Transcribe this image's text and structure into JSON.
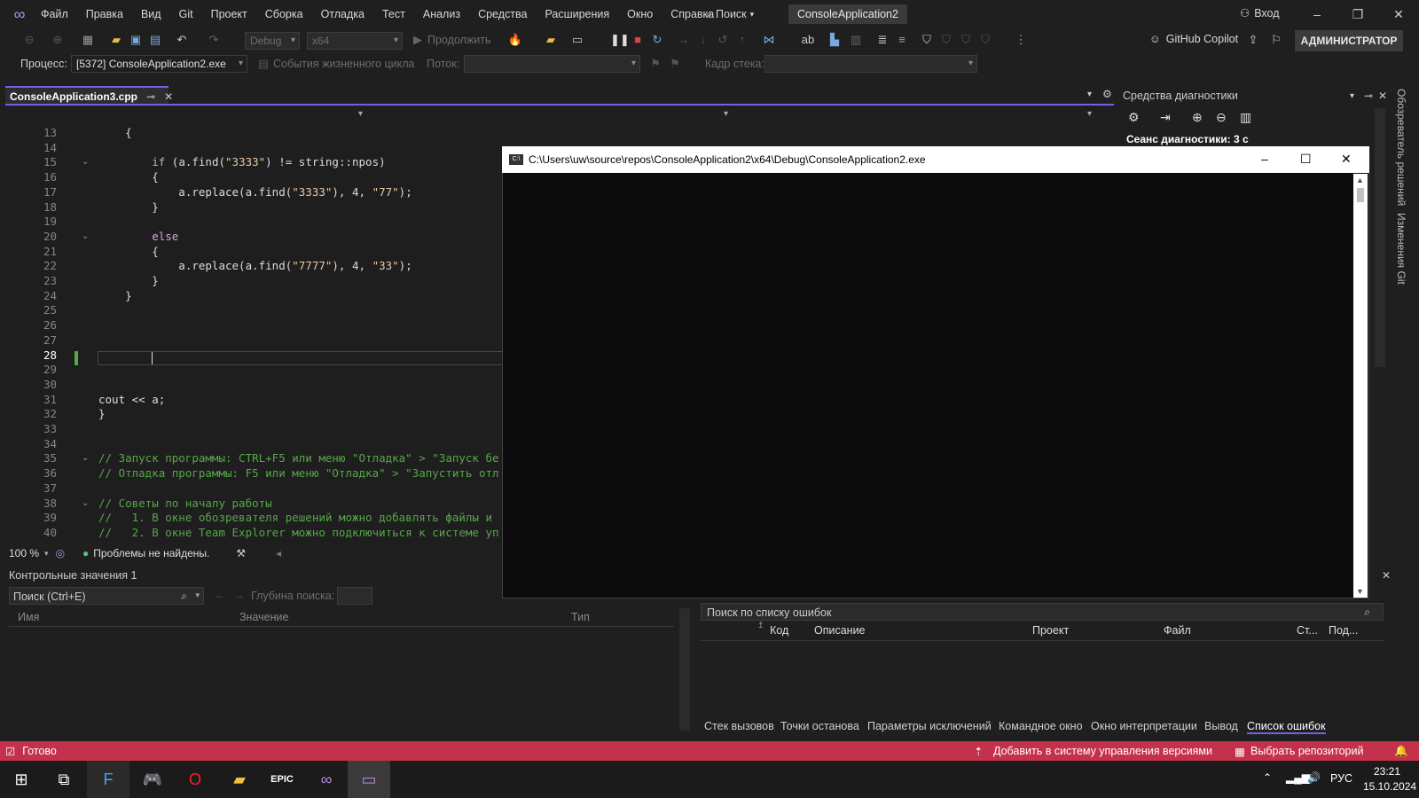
{
  "menu": [
    "Файл",
    "Правка",
    "Вид",
    "Git",
    "Проект",
    "Сборка",
    "Отладка",
    "Тест",
    "Анализ",
    "Средства",
    "Расширения",
    "Окно",
    "Справка"
  ],
  "search_label": "Поиск",
  "solution_name": "ConsoleApplication2",
  "login": "Вход",
  "toolbar": {
    "config": "Debug",
    "platform": "x64",
    "continue": "Продолжить",
    "copilot": "GitHub Copilot",
    "admin": "АДМИНИСТРАТОР"
  },
  "toolbar2": {
    "process_label": "Процесс:",
    "process_value": "[5372] ConsoleApplication2.exe",
    "lifecycle": "События жизненного цикла",
    "thread_label": "Поток:",
    "stack_label": "Кадр стека:"
  },
  "doc_tab": "ConsoleApplication3.cpp",
  "editor": {
    "lines": [
      {
        "n": "13",
        "t": "    {"
      },
      {
        "n": "14",
        "t": ""
      },
      {
        "n": "15",
        "t": "        if (a.find(\"3333\") != string::npos)"
      },
      {
        "n": "16",
        "t": "        {"
      },
      {
        "n": "17",
        "t": "            a.replace(a.find(\"3333\"), 4, \"77\");"
      },
      {
        "n": "18",
        "t": "        }"
      },
      {
        "n": "19",
        "t": ""
      },
      {
        "n": "20",
        "t": "        else"
      },
      {
        "n": "21",
        "t": "        {"
      },
      {
        "n": "22",
        "t": "            a.replace(a.find(\"7777\"), 4, \"33\");"
      },
      {
        "n": "23",
        "t": "        }"
      },
      {
        "n": "24",
        "t": "    }"
      },
      {
        "n": "25",
        "t": ""
      },
      {
        "n": "26",
        "t": ""
      },
      {
        "n": "27",
        "t": ""
      },
      {
        "n": "28",
        "t": ""
      },
      {
        "n": "29",
        "t": ""
      },
      {
        "n": "30",
        "t": ""
      },
      {
        "n": "31",
        "t": "cout << a;"
      },
      {
        "n": "32",
        "t": "}"
      },
      {
        "n": "33",
        "t": ""
      },
      {
        "n": "34",
        "t": ""
      },
      {
        "n": "35",
        "t": "// Запуск программы: CTRL+F5 или меню \"Отладка\" > \"Запуск бе"
      },
      {
        "n": "36",
        "t": "// Отладка программы: F5 или меню \"Отладка\" > \"Запустить отл"
      },
      {
        "n": "37",
        "t": ""
      },
      {
        "n": "38",
        "t": "// Советы по началу работы"
      },
      {
        "n": "39",
        "t": "//   1. В окне обозревателя решений можно добавлять файлы и"
      },
      {
        "n": "40",
        "t": "//   2. В окне Team Explorer можно подключиться к системе уп"
      }
    ],
    "zoom": "100 %",
    "no_issues": "Проблемы не найдены."
  },
  "diagnostics": {
    "title": "Средства диагностики",
    "session": "Сеанс диагностики: 3 с"
  },
  "vertical_tabs": [
    "Обозреватель решений",
    "Изменения Git"
  ],
  "console": {
    "title": "C:\\Users\\uw\\source\\repos\\ConsoleApplication2\\x64\\Debug\\ConsoleApplication2.exe"
  },
  "watch": {
    "title": "Контрольные значения 1",
    "search": "Поиск (Ctrl+E)",
    "depth": "Глубина поиска:",
    "cols": [
      "Имя",
      "Значение",
      "Тип"
    ]
  },
  "errors": {
    "search": "Поиск по списку ошибок",
    "cols": [
      "Код",
      "Описание",
      "Проект",
      "Файл",
      "Ст...",
      "Под..."
    ]
  },
  "bottom_tabs": [
    "Стек вызовов",
    "Точки останова",
    "Параметры исключений",
    "Командное окно",
    "Окно интерпретации",
    "Вывод",
    "Список ошибок"
  ],
  "status": {
    "ready": "Готово",
    "add_vcs": "Добавить в систему управления версиями",
    "repo": "Выбрать репозиторий"
  },
  "taskbar": {
    "lang": "РУС",
    "time": "23:21",
    "date": "15.10.2024"
  }
}
